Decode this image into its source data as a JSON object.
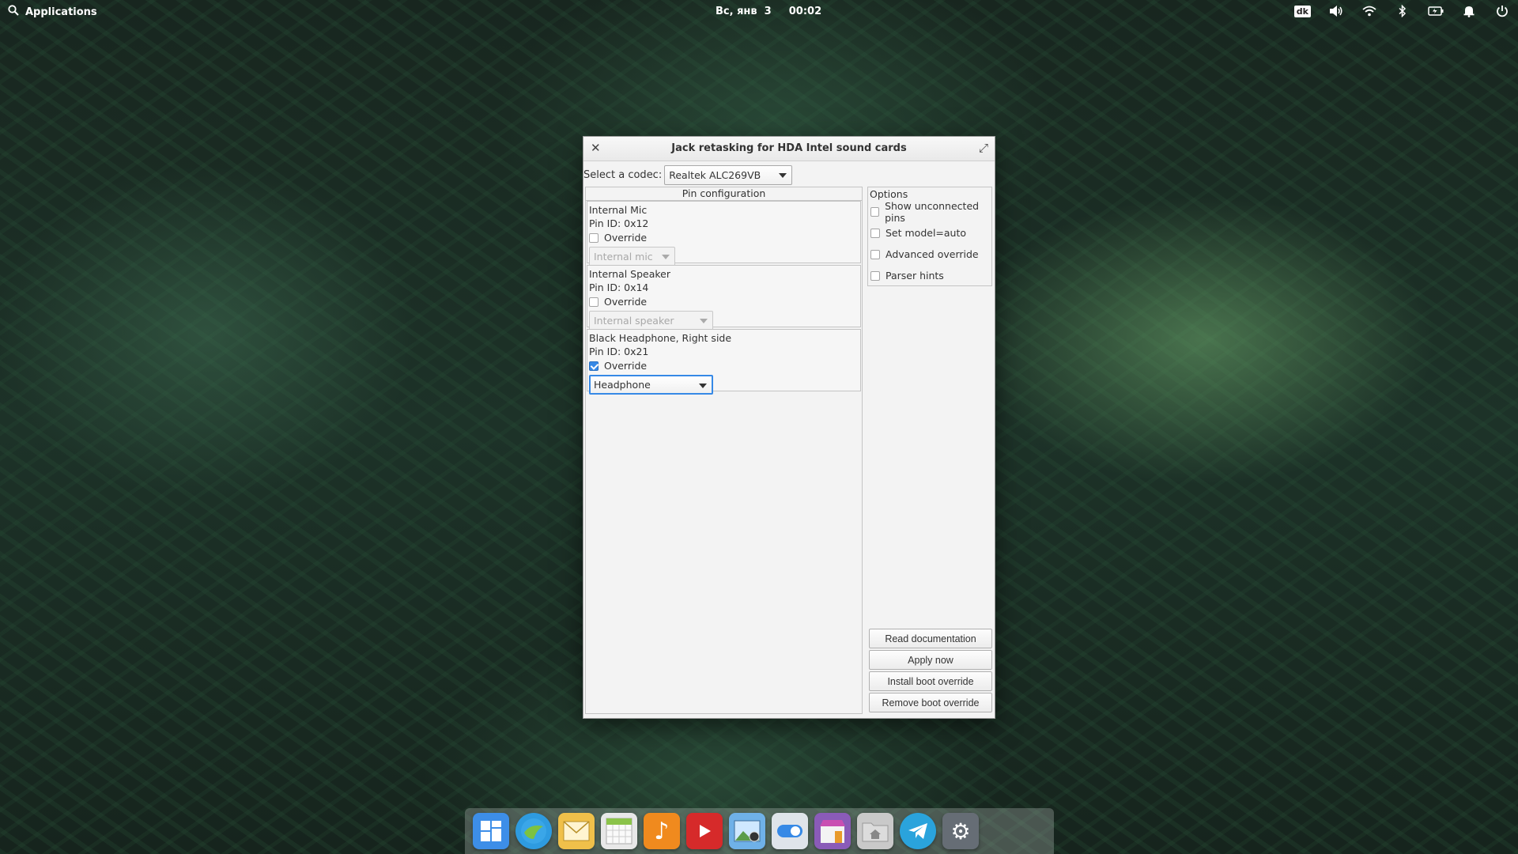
{
  "panel": {
    "applications_label": "Applications",
    "date": "Вс, янв  3",
    "time": "00:02",
    "keyboard_layout": "dk"
  },
  "window": {
    "title": "Jack retasking for HDA Intel sound cards",
    "codec_label": "Select a codec:",
    "codec_value": "Realtek ALC269VB",
    "pin_config_title": "Pin configuration",
    "pins": [
      {
        "name": "Internal Mic",
        "pin_id": "Pin ID: 0x12",
        "override_label": "Override",
        "override_checked": false,
        "select_value": "Internal mic"
      },
      {
        "name": "Internal Speaker",
        "pin_id": "Pin ID: 0x14",
        "override_label": "Override",
        "override_checked": false,
        "select_value": "Internal speaker"
      },
      {
        "name": "Black Headphone, Right side",
        "pin_id": "Pin ID: 0x21",
        "override_label": "Override",
        "override_checked": true,
        "select_value": "Headphone"
      }
    ],
    "options_title": "Options",
    "options": [
      {
        "label": "Show unconnected pins",
        "checked": false
      },
      {
        "label": "Set model=auto",
        "checked": false
      },
      {
        "label": "Advanced override",
        "checked": false
      },
      {
        "label": "Parser hints",
        "checked": false
      }
    ],
    "buttons": {
      "read_doc": "Read documentation",
      "apply": "Apply now",
      "install_boot": "Install boot override",
      "remove_boot": "Remove boot override"
    }
  },
  "dock": [
    {
      "icon": "multitasking-view-icon",
      "color": "#3d8ee8"
    },
    {
      "icon": "web-browser-icon",
      "color": "#2e9be0"
    },
    {
      "icon": "mail-icon",
      "color": "#f0c04a"
    },
    {
      "icon": "calendar-icon",
      "color": "#e8e8e8"
    },
    {
      "icon": "music-icon",
      "color": "#f08a1e"
    },
    {
      "icon": "videos-icon",
      "color": "#d62a2a"
    },
    {
      "icon": "photos-icon",
      "color": "#6fb1e8"
    },
    {
      "icon": "system-settings-switch-icon",
      "color": "#dfe4ea"
    },
    {
      "icon": "appcenter-icon",
      "color": "#8a5bb8"
    },
    {
      "icon": "files-icon",
      "color": "#c9c9c9"
    },
    {
      "icon": "telegram-icon",
      "color": "#2aa3dc"
    },
    {
      "icon": "settings-gear-icon",
      "color": "#666d75"
    }
  ]
}
